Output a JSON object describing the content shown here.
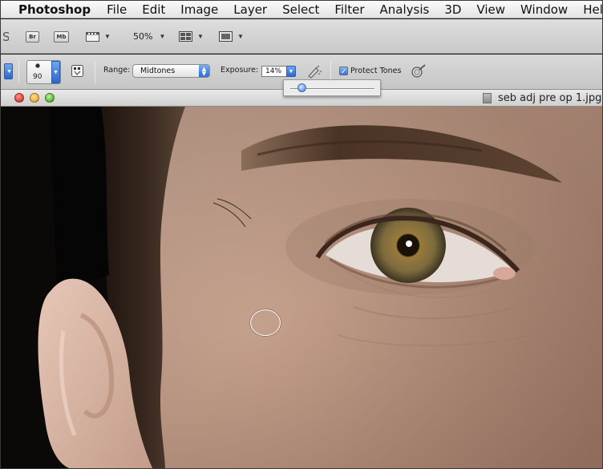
{
  "menubar": {
    "app_name": "Photoshop",
    "items": [
      "File",
      "Edit",
      "Image",
      "Layer",
      "Select",
      "Filter",
      "Analysis",
      "3D",
      "View",
      "Window",
      "Help"
    ]
  },
  "appbar": {
    "bridge_label": "Br",
    "minibridge_label": "Mb",
    "zoom": "50%"
  },
  "options": {
    "brush_size": "90",
    "range_label": "Range:",
    "range_value": "Midtones",
    "exposure_label": "Exposure:",
    "exposure_value": "14%",
    "exposure_fraction": 0.14,
    "protect_tones_label": "Protect Tones",
    "protect_tones_checked": true
  },
  "document": {
    "title": "seb adj pre op 1.jpg"
  },
  "colors": {
    "accent": "#2f6fd6",
    "close": "#e2483f",
    "minimize": "#f4b23a",
    "zoom": "#5fbf3f"
  }
}
